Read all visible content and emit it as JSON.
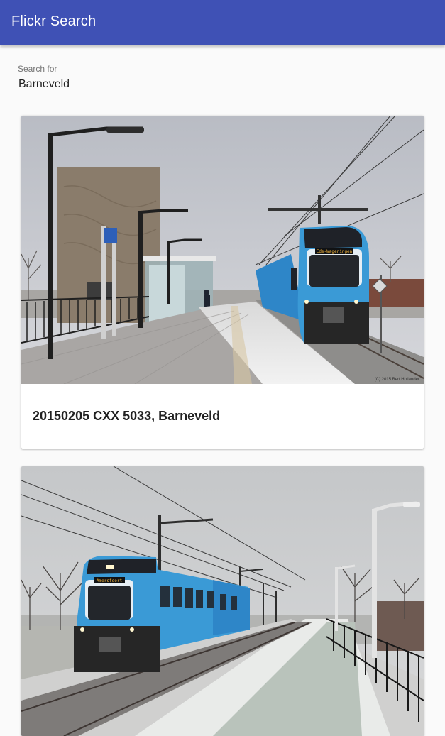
{
  "app": {
    "title": "Flickr Search"
  },
  "search": {
    "label": "Search for",
    "value": "Barneveld"
  },
  "results": [
    {
      "title": "20150205 CXX 5033, Barneveld",
      "image_alt": "Blue and white train at a snowy station platform",
      "watermark": "(C) 2015 Bert Hollander",
      "destination_sign": "Ede-Wageningen"
    },
    {
      "title": "",
      "image_alt": "Blue and white train on snowy tracks",
      "destination_sign": "Amersfoort"
    }
  ],
  "colors": {
    "appbar": "#3f51b5",
    "train_blue": "#3a9ad6"
  }
}
